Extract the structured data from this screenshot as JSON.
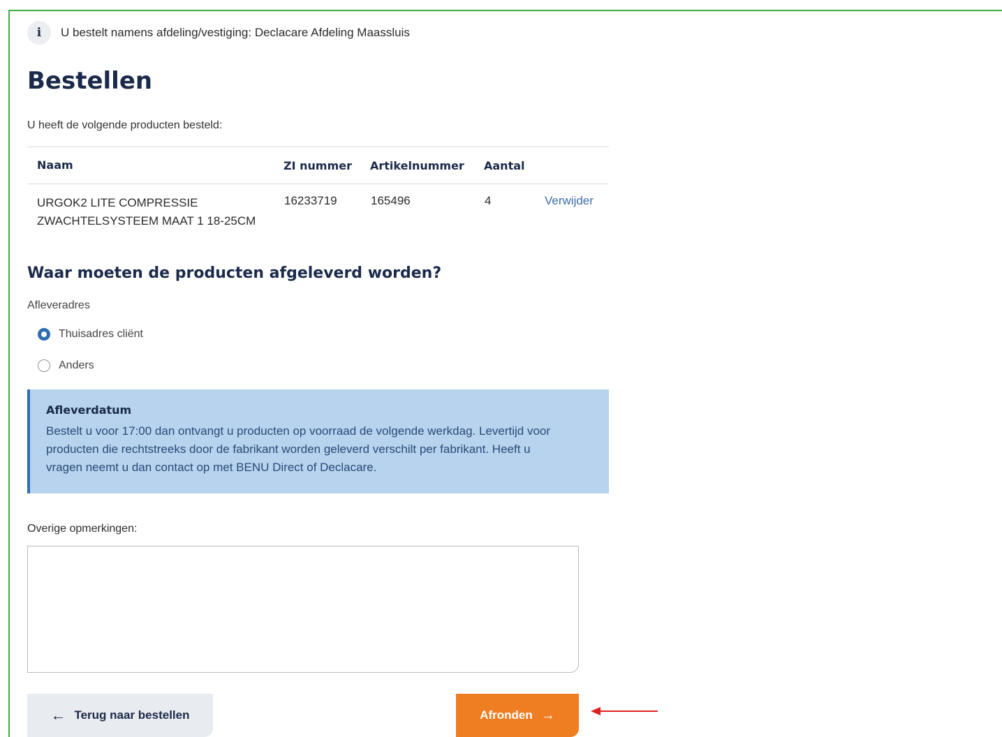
{
  "info": {
    "icon_letter": "i",
    "text": "U bestelt namens afdeling/vestiging: Declacare Afdeling Maassluis"
  },
  "page_title": "Bestellen",
  "intro": "U heeft de volgende producten besteld:",
  "table": {
    "headers": [
      "Naam",
      "ZI nummer",
      "Artikelnummer",
      "Aantal"
    ],
    "rows": [
      {
        "name_line1": "URGOK2 LITE COMPRESSIE",
        "name_line2": "ZWACHTELSYSTEEM MAAT 1 18-25CM",
        "zi": "16233719",
        "article": "165496",
        "quantity": "4",
        "action": "Verwijder"
      }
    ]
  },
  "delivery": {
    "heading": "Waar moeten de producten afgeleverd worden?",
    "address_label": "Afleveradres",
    "options": [
      {
        "label": "Thuisadres cliënt",
        "selected": true
      },
      {
        "label": "Anders",
        "selected": false
      }
    ]
  },
  "notice": {
    "title": "Afleverdatum",
    "line1": "Bestelt u voor 17:00 dan ontvangt u producten op voorraad de volgende werkdag. Levertijd voor",
    "line2": "producten die rechtstreeks door de fabrikant worden geleverd verschilt per fabrikant. Heeft u",
    "line3": "vragen neemt u dan contact op met BENU Direct of Declacare."
  },
  "notes": {
    "label": "Overige opmerkingen:",
    "value": ""
  },
  "buttons": {
    "back_label": "Terug naar bestellen",
    "finish_label": "Afronden"
  },
  "colors": {
    "accent": "#ef7d22",
    "primary": "#2f6cb0",
    "frame": "#3cb043",
    "annotation": "#e02020"
  }
}
